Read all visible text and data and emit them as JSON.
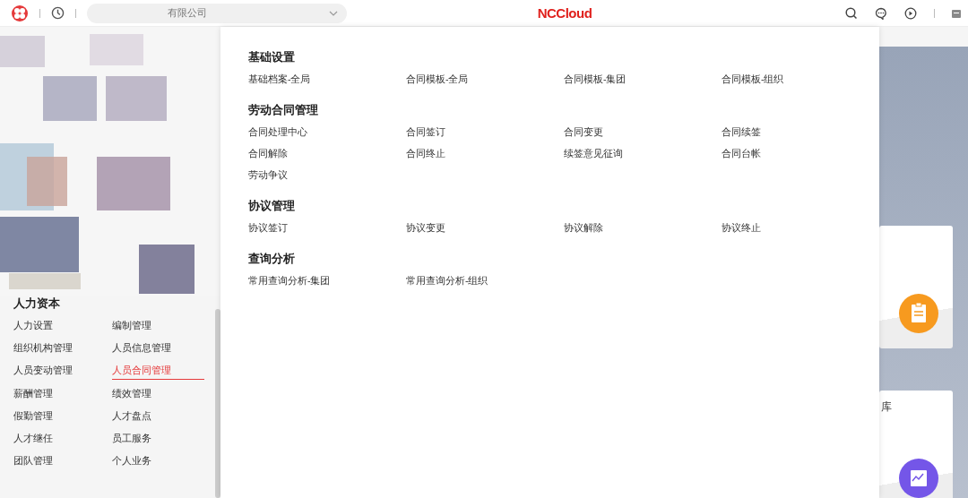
{
  "topbar": {
    "company": "有限公司",
    "logo": "NCCloud"
  },
  "sidebar": {
    "title": "人力资本",
    "items": [
      {
        "label": "人力设置",
        "selected": false
      },
      {
        "label": "编制管理",
        "selected": false
      },
      {
        "label": "组织机构管理",
        "selected": false
      },
      {
        "label": "人员信息管理",
        "selected": false
      },
      {
        "label": "人员变动管理",
        "selected": false
      },
      {
        "label": "人员合同管理",
        "selected": true
      },
      {
        "label": "薪酬管理",
        "selected": false
      },
      {
        "label": "绩效管理",
        "selected": false
      },
      {
        "label": "假勤管理",
        "selected": false
      },
      {
        "label": "人才盘点",
        "selected": false
      },
      {
        "label": "人才继任",
        "selected": false
      },
      {
        "label": "员工服务",
        "selected": false
      },
      {
        "label": "团队管理",
        "selected": false
      },
      {
        "label": "个人业务",
        "selected": false
      }
    ]
  },
  "menu": {
    "sections": [
      {
        "title": "基础设置",
        "items": [
          "基础档案-全局",
          "合同模板-全局",
          "合同模板-集团",
          "合同模板-组织"
        ]
      },
      {
        "title": "劳动合同管理",
        "items": [
          "合同处理中心",
          "合同签订",
          "合同变更",
          "合同续签",
          "合同解除",
          "合同终止",
          "续签意见征询",
          "合同台帐",
          "劳动争议"
        ]
      },
      {
        "title": "协议管理",
        "items": [
          "协议签订",
          "协议变更",
          "协议解除",
          "协议终止"
        ]
      },
      {
        "title": "查询分析",
        "items": [
          "常用查询分析-集团",
          "常用查询分析-组织"
        ]
      }
    ]
  },
  "cards": [
    {
      "kind": "task"
    },
    {
      "kind": "report",
      "text": "库"
    }
  ]
}
